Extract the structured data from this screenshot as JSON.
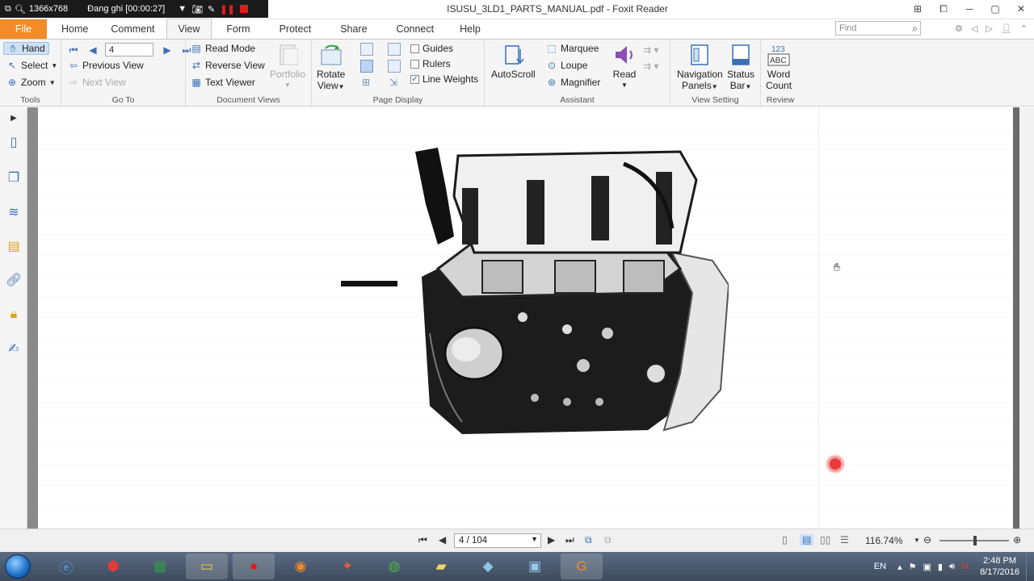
{
  "recorder": {
    "resolution": "1366x768",
    "status": "Đang ghi [00:00:27]"
  },
  "window": {
    "title": "ISUSU_3LD1_PARTS_MANUAL.pdf - Foxit Reader"
  },
  "menu": {
    "tabs": [
      "File",
      "Home",
      "Comment",
      "View",
      "Form",
      "Protect",
      "Share",
      "Connect",
      "Help"
    ],
    "active": "View"
  },
  "find": {
    "placeholder": "Find"
  },
  "ribbon": {
    "tools": {
      "hand": "Hand",
      "select": "Select",
      "zoom": "Zoom",
      "label": "Tools"
    },
    "goto": {
      "page_value": "4",
      "previous_view": "Previous View",
      "next_view": "Next View",
      "label": "Go To"
    },
    "document_views": {
      "read_mode": "Read Mode",
      "reverse_view": "Reverse View",
      "text_viewer": "Text Viewer",
      "portfolio": "Portfolio",
      "label": "Document Views"
    },
    "rotate": {
      "line1": "Rotate",
      "line2": "View"
    },
    "page_display": {
      "guides": "Guides",
      "rulers": "Rulers",
      "line_weights": "Line Weights",
      "label": "Page Display"
    },
    "autoscroll": "AutoScroll",
    "assistant": {
      "marquee": "Marquee",
      "loupe": "Loupe",
      "magnifier": "Magnifier",
      "read": "Read",
      "label": "Assistant"
    },
    "view_setting": {
      "nav_line1": "Navigation",
      "nav_line2": "Panels",
      "status_line1": "Status",
      "status_line2": "Bar",
      "label": "View Setting"
    },
    "review": {
      "word_count_line1": "Word",
      "word_count_line2": "Count",
      "label": "Review"
    }
  },
  "status": {
    "page_indicator": "4 / 104",
    "zoom": "116.74%"
  },
  "clock": {
    "time": "2:48 PM",
    "date": "8/17/2016"
  },
  "tray": {
    "lang": "EN"
  },
  "colors": {
    "file_tab": "#f28c28",
    "accent": "#3a6fb5",
    "record": "#e21b1b"
  }
}
